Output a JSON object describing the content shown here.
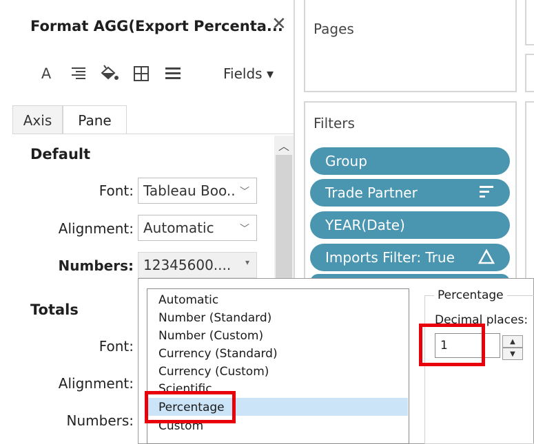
{
  "format_pane": {
    "title": "Format AGG(Export Percenta...",
    "close_glyph": "✕",
    "toolbar": {
      "icons": [
        "font-icon",
        "align-icon",
        "shading-icon",
        "borders-icon",
        "lines-icon"
      ],
      "font_glyph": "A",
      "align_glyph": "≡",
      "shading_glyph": "◈",
      "borders_glyph": "⊞",
      "lines_glyph": "☰",
      "fields_label": "Fields",
      "fields_caret": "▾"
    },
    "tabs": [
      {
        "label": "Axis",
        "active": false
      },
      {
        "label": "Pane",
        "active": true
      }
    ],
    "default_section": {
      "heading": "Default",
      "font_label": "Font:",
      "font_value": "Tableau Boo..",
      "alignment_label": "Alignment:",
      "alignment_value": "Automatic",
      "numbers_label": "Numbers:",
      "numbers_value": "12345600...."
    },
    "totals_section": {
      "heading": "Totals",
      "font_label": "Font:",
      "alignment_label": "Alignment:",
      "numbers_label": "Numbers:"
    },
    "scroll_up_glyph": "︿",
    "chevron_glyph": "﹀",
    "small_caret": "▾"
  },
  "shelves": {
    "pages_title": "Pages",
    "filters_title": "Filters",
    "filters": [
      {
        "label": "Group",
        "icon": ""
      },
      {
        "label": "Trade Partner",
        "icon": "sort-icon"
      },
      {
        "label": "YEAR(Date)",
        "icon": ""
      },
      {
        "label": "Imports Filter: True",
        "icon": "delta-icon"
      }
    ],
    "sort_glyph": "≡",
    "delta_glyph": "△"
  },
  "number_format_popup": {
    "options": [
      "Automatic",
      "Number (Standard)",
      "Number (Custom)",
      "Currency (Standard)",
      "Currency (Custom)",
      "Scientific",
      "Percentage",
      "Custom"
    ],
    "selected": "Percentage",
    "group_title": "Percentage",
    "decimal_places_label": "Decimal places:",
    "decimal_places_value": "1",
    "spin_up_glyph": "▲",
    "spin_down_glyph": "▼"
  },
  "colors": {
    "pill": "#4a96b0",
    "highlight": "#e8000b",
    "selection": "#cce4f7"
  }
}
